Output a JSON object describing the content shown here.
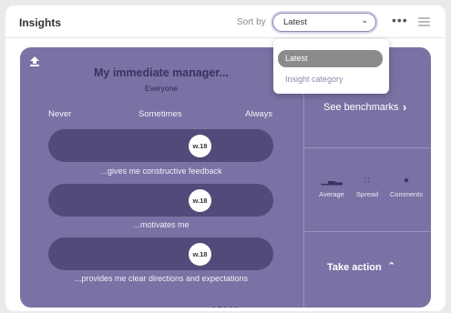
{
  "header": {
    "title": "Insights",
    "sort_label": "Sort by",
    "sort_value": "Latest",
    "more_icon": "more-horizontal-icon",
    "menu_icon": "hamburger-icon"
  },
  "dropdown": {
    "options": [
      "Latest",
      "Insight category"
    ],
    "selected": "Latest"
  },
  "card": {
    "title": "My immediate manager...",
    "subtitle": "Everyone",
    "scale": {
      "low": "Never",
      "mid": "Sometimes",
      "high": "Always"
    },
    "statements": [
      {
        "marker": "w.18",
        "level": 0.675,
        "text": "...gives me constructive feedback"
      },
      {
        "marker": "w.18",
        "level": 0.675,
        "text": "...motivates me"
      },
      {
        "marker": "w.18",
        "level": 0.675,
        "text": "...provides me clear directions and expectations"
      }
    ],
    "benchmarks_label": "See benchmarks",
    "metrics": [
      {
        "label": "Average",
        "icon": "bar-chart-icon"
      },
      {
        "label": "Spread",
        "icon": "scatter-icon"
      },
      {
        "label": "Comments",
        "icon": "comment-icon"
      }
    ],
    "take_action_label": "Take action",
    "pager": {
      "pages": 5,
      "current": 2
    }
  },
  "colors": {
    "card": "#7b71a4",
    "bar": "#524a78",
    "accent": "#8d87ae"
  }
}
